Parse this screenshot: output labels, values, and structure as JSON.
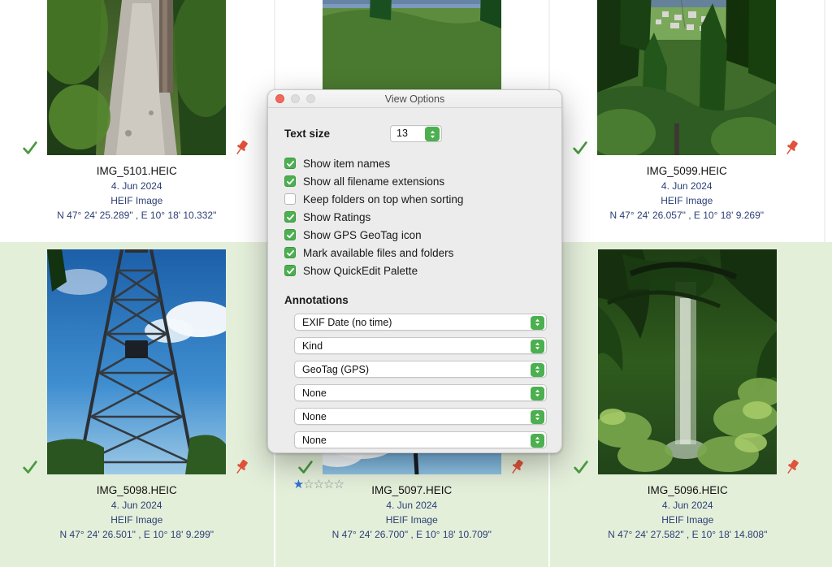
{
  "grid": {
    "rows": [
      {
        "selected": false,
        "background_color": "#ffffff",
        "items": [
          {
            "filename": "IMG_5101.HEIC",
            "date": "4. Jun 2024",
            "kind": "HEIF Image",
            "geotag": "N 47° 24' 25.289\" , E 10° 18' 10.332\"",
            "checked": true,
            "pinned": true,
            "rating": null,
            "scene": "forest-trail-hiker"
          },
          {
            "filename": "",
            "date": "",
            "kind": "",
            "geotag": "",
            "checked": false,
            "pinned": false,
            "rating": null,
            "scene": "gondola-cable-car"
          },
          {
            "filename": "IMG_5099.HEIC",
            "date": "4. Jun 2024",
            "kind": "HEIF Image",
            "geotag": "N 47° 24' 26.057\" , E 10° 18' 9.269\"",
            "checked": true,
            "pinned": true,
            "rating": null,
            "scene": "valley-overlook"
          }
        ]
      },
      {
        "selected": true,
        "background_color": "#e4efda",
        "items": [
          {
            "filename": "IMG_5098.HEIC",
            "date": "4. Jun 2024",
            "kind": "HEIF Image",
            "geotag": "N 47° 24' 26.501\" , E 10° 18' 9.299\"",
            "checked": true,
            "pinned": true,
            "rating": null,
            "scene": "steel-tower-upward"
          },
          {
            "filename": "IMG_5097.HEIC",
            "date": "4. Jun 2024",
            "kind": "HEIF Image",
            "geotag": "N 47° 24' 26.700\" , E 10° 18' 10.709\"",
            "checked": true,
            "pinned": true,
            "rating": 1,
            "rating_max": 5,
            "scene": "pylon-blue-sky"
          },
          {
            "filename": "IMG_5096.HEIC",
            "date": "4. Jun 2024",
            "kind": "HEIF Image",
            "geotag": "N 47° 24' 27.582\" , E 10° 18' 14.808\"",
            "checked": true,
            "pinned": true,
            "rating": null,
            "scene": "forest-waterfall"
          }
        ]
      }
    ]
  },
  "dialog": {
    "title": "View Options",
    "window_buttons": {
      "close": "close-button",
      "minimize": "minimize-button",
      "zoom": "zoom-button"
    },
    "text_size": {
      "label": "Text size",
      "value": "13"
    },
    "checkboxes": [
      {
        "label": "Show item names",
        "checked": true
      },
      {
        "label": "Show all filename extensions",
        "checked": true
      },
      {
        "label": "Keep folders on top when sorting",
        "checked": false
      },
      {
        "label": "Show Ratings",
        "checked": true
      },
      {
        "label": "Show GPS GeoTag icon",
        "checked": true
      },
      {
        "label": "Mark available files and folders",
        "checked": true
      },
      {
        "label": "Show QuickEdit Palette",
        "checked": true
      }
    ],
    "annotations": {
      "title": "Annotations",
      "selects": [
        {
          "value": "EXIF Date (no time)"
        },
        {
          "value": "Kind"
        },
        {
          "value": "GeoTag (GPS)"
        },
        {
          "value": "None"
        },
        {
          "value": "None"
        },
        {
          "value": "None"
        }
      ]
    }
  },
  "colors": {
    "accent_green": "#4cb050",
    "selection_row": "#e4efda",
    "meta_text": "#2b3f75",
    "star_on": "#2d6fd4",
    "pin_red": "#e0523a",
    "check_green": "#4a9a3f"
  },
  "icons": {
    "check": "check-icon",
    "pin": "pin-icon",
    "star_filled": "★",
    "star_empty": "☆",
    "stepper": "stepper-arrows-icon",
    "popup_arrows": "popup-arrows-icon"
  }
}
